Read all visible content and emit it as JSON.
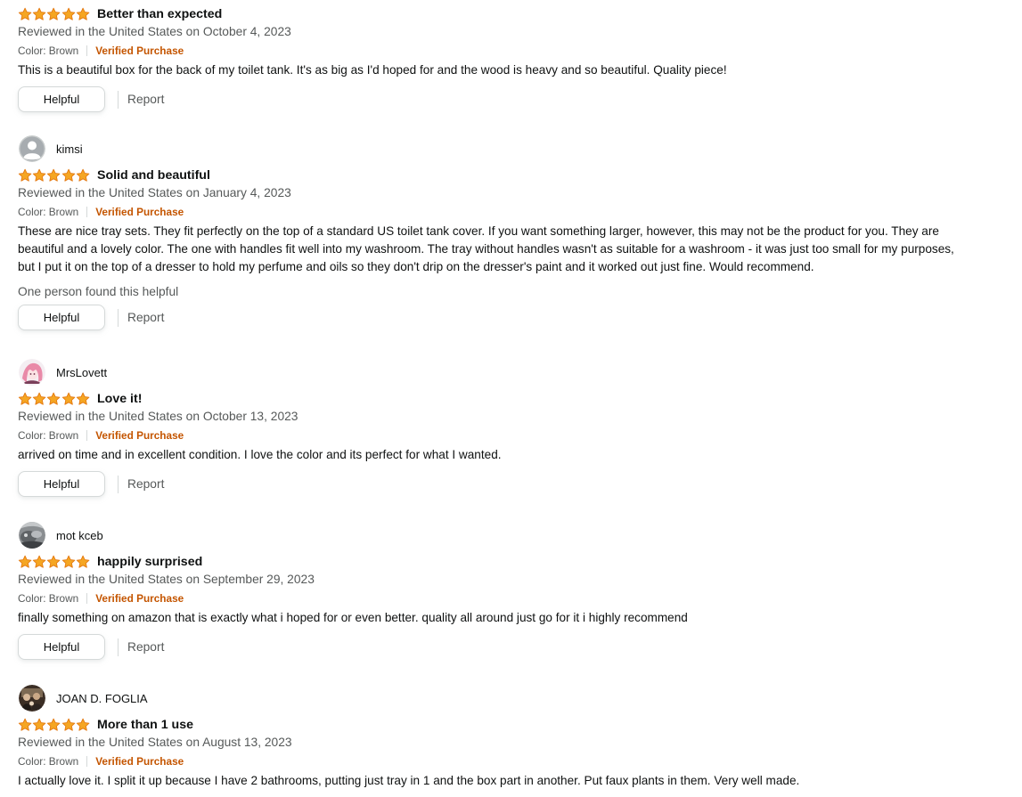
{
  "reviews": [
    {
      "profile_name": "",
      "rating": 5,
      "title": "Better than expected",
      "reviewed": "Reviewed in the United States on October 4, 2023",
      "color": "Color: Brown",
      "verified": "Verified Purchase",
      "body": [
        "This is a beautiful box for the back of my toilet tank. It's as big as I'd hoped for and the wood is heavy and so beautiful. Quality piece!"
      ],
      "helpful_count": "",
      "helpful_label": "Helpful",
      "report_label": "Report"
    },
    {
      "profile_name": "kimsi",
      "avatar": "default-avatar",
      "rating": 5,
      "title": "Solid and beautiful",
      "reviewed": "Reviewed in the United States on January 4, 2023",
      "color": "Color: Brown",
      "verified": "Verified Purchase",
      "body": [
        "These are nice tray sets. They fit perfectly on the top of a standard US toilet tank cover. If you want something larger, however, this may not be the product for you. They are",
        "beautiful and a lovely color. The one with handles fit well into my washroom. The tray without handles wasn't as suitable for a washroom - it was just too small for my purposes,",
        "but I put it on the top of a dresser to hold my perfume and oils so they don't drip on the dresser's paint and it worked out just fine. Would recommend."
      ],
      "helpful_count": "One person found this helpful",
      "helpful_label": "Helpful",
      "report_label": "Report"
    },
    {
      "profile_name": "MrsLovett",
      "avatar": "anime-avatar",
      "rating": 5,
      "title": "Love it!",
      "reviewed": "Reviewed in the United States on October 13, 2023",
      "color": "Color: Brown",
      "verified": "Verified Purchase",
      "body": [
        "arrived on time and in excellent condition. I love the color and its perfect for what I wanted."
      ],
      "helpful_count": "",
      "helpful_label": "Helpful",
      "report_label": "Report"
    },
    {
      "profile_name": "mot kceb",
      "avatar": "photo-avatar",
      "rating": 5,
      "title": "happily surprised",
      "reviewed": "Reviewed in the United States on September 29, 2023",
      "color": "Color: Brown",
      "verified": "Verified Purchase",
      "body": [
        "finally something on amazon that is exactly what i hoped for or even better. quality all around just go for it i highly recommend"
      ],
      "helpful_count": "",
      "helpful_label": "Helpful",
      "report_label": "Report"
    },
    {
      "profile_name": "JOAN D. FOGLIA",
      "avatar": "photo-avatar",
      "rating": 5,
      "title": "More than 1 use",
      "reviewed": "Reviewed in the United States on August 13, 2023",
      "color": "Color: Brown",
      "verified": "Verified Purchase",
      "body": [
        "I actually love it. I split it up because I have 2 bathrooms, putting just tray in 1 and the box part in another. Put faux plants in them. Very well made."
      ],
      "helpful_count": "",
      "helpful_label": "Helpful",
      "report_label": "Report"
    }
  ],
  "colors": {
    "star": "#f5a623",
    "star_outline": "#e47911",
    "verified": "#c45500",
    "secondary_text": "#565959",
    "border": "#d5d9d9"
  }
}
